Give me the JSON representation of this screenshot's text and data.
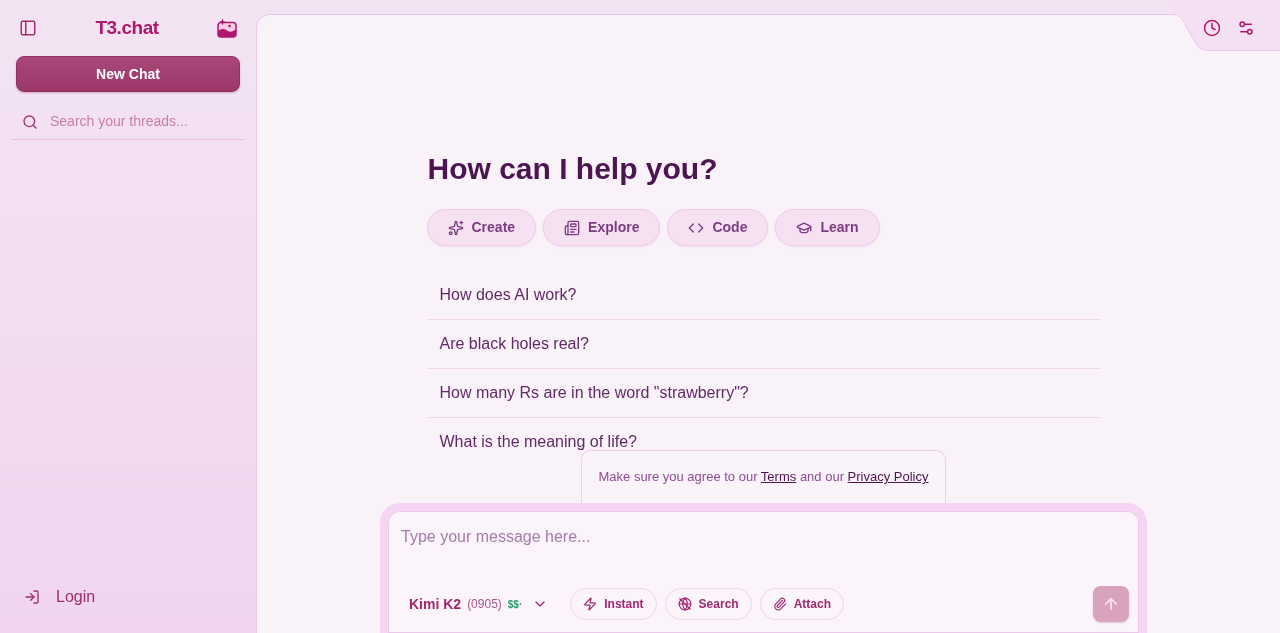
{
  "sidebar": {
    "logo": "T3.chat",
    "new_chat_button": "New Chat",
    "search": {
      "placeholder": "Search your threads..."
    },
    "login_button": "Login"
  },
  "main": {
    "heading": "How can I help you?",
    "categories": [
      {
        "kind": "create",
        "label": "Create"
      },
      {
        "kind": "explore",
        "label": "Explore"
      },
      {
        "kind": "code",
        "label": "Code"
      },
      {
        "kind": "learn",
        "label": "Learn"
      }
    ],
    "suggestions": [
      "How does AI work?",
      "Are black holes real?",
      "How many Rs are in the word \"strawberry\"?",
      "What is the meaning of life?"
    ],
    "notice": [
      {
        "kind": "text",
        "text": "Make sure you agree to our"
      },
      {
        "kind": "link",
        "text": "Terms"
      },
      {
        "kind": "text",
        "text": "and our"
      },
      {
        "kind": "link",
        "text": "Privacy Policy"
      }
    ]
  },
  "composer": {
    "placeholder": "Type your message here...",
    "model": {
      "name": "Kimi K2",
      "version": "(0905)",
      "cost": "$$·"
    },
    "tools": [
      {
        "kind": "instant",
        "label": "Instant"
      },
      {
        "kind": "search",
        "label": "Search"
      },
      {
        "kind": "attach",
        "label": "Attach"
      }
    ],
    "send_button": {
      "disabled": true
    }
  }
}
